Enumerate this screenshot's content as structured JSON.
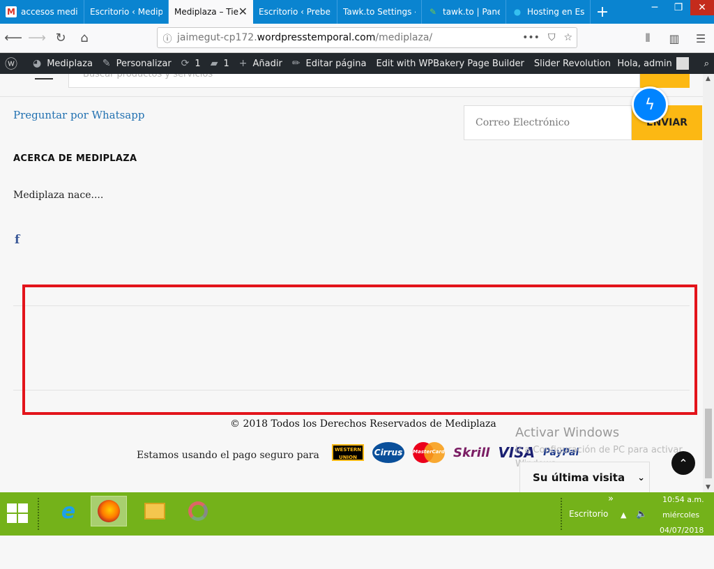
{
  "browser": {
    "tabs": [
      {
        "label": "accesos medip",
        "icon": "gmail-icon",
        "active": false
      },
      {
        "label": "Escritorio ‹ Medipla",
        "icon": "wordpress-icon",
        "active": false
      },
      {
        "label": "Mediplaza – Tie",
        "icon": "",
        "active": true
      },
      {
        "label": "Escritorio ‹ Preben",
        "icon": "",
        "active": false
      },
      {
        "label": "Tawk.to Settings ‹ F",
        "icon": "",
        "active": false
      },
      {
        "label": "tawk.to | Panel",
        "icon": "tawk-icon",
        "active": false
      },
      {
        "label": "Hosting en Esp",
        "icon": "dot-icon",
        "active": false
      }
    ],
    "url_pre": "jaimegut-cp172.",
    "url_host": "wordpresstemporal.com",
    "url_path": "/mediplaza/"
  },
  "wp_admin_bar": {
    "site": "Mediplaza",
    "customize": "Personalizar",
    "updates": "1",
    "comments": "1",
    "add": "Añadir",
    "edit_page": "Editar página",
    "wpbakery": "Edit with WPBakery Page Builder",
    "slider": "Slider Revolution",
    "greeting": "Hola, admin"
  },
  "page": {
    "search_placeholder": "Buscar productos y servicios",
    "whatsapp_link": "Preguntar por Whatsapp",
    "email_placeholder": "Correo Electrónico",
    "send_button": "ENVIAR",
    "about_title": "ACERCA DE MEDIPLAZA",
    "about_text": "Mediplaza nace....",
    "facebook": "f",
    "copyright": "© 2018 Todos los Derechos Reservados de Mediplaza",
    "payment_text": "Estamos usando el pago seguro para",
    "payment_logos": {
      "wu_line1": "WESTERN",
      "wu_line2": "UNION",
      "cirrus": "Cirrus",
      "mastercard": "MasterCard",
      "skrill": "Skrill",
      "visa": "VISA",
      "paypal": "PayPal"
    },
    "activate_title": "Activar Windows",
    "activate_sub": "Ir a Configuración de PC para activar Windows.",
    "last_visit": "Su última visita"
  },
  "taskbar": {
    "desktop_label": "Escritorio",
    "chevrons": "»",
    "time": "10:54 a.m.",
    "day": "miércoles",
    "date": "04/07/2018"
  },
  "colors": {
    "accent_yellow": "#fcb813",
    "browser_blue": "#0a84d0",
    "highlight_red": "#e3141b",
    "taskbar_green": "#74b21a"
  }
}
